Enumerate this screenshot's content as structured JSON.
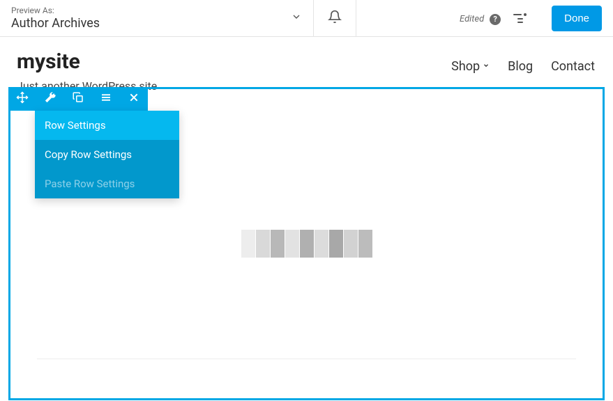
{
  "topbar": {
    "preview_label": "Preview As:",
    "preview_value": "Author Archives",
    "edited_label": "Edited",
    "done_label": "Done"
  },
  "header": {
    "site_title": "mysite",
    "tagline": "Just another WordPress site",
    "nav": [
      {
        "label": "Shop",
        "hasChevron": true
      },
      {
        "label": "Blog",
        "hasChevron": false
      },
      {
        "label": "Contact",
        "hasChevron": false
      }
    ]
  },
  "toolbar": {
    "items": [
      "move",
      "wrench",
      "copy",
      "list",
      "close"
    ]
  },
  "menu": {
    "items": [
      {
        "label": "Row Settings",
        "state": "selected"
      },
      {
        "label": "Copy Row Settings",
        "state": "normal"
      },
      {
        "label": "Paste Row Settings",
        "state": "disabled"
      }
    ]
  }
}
